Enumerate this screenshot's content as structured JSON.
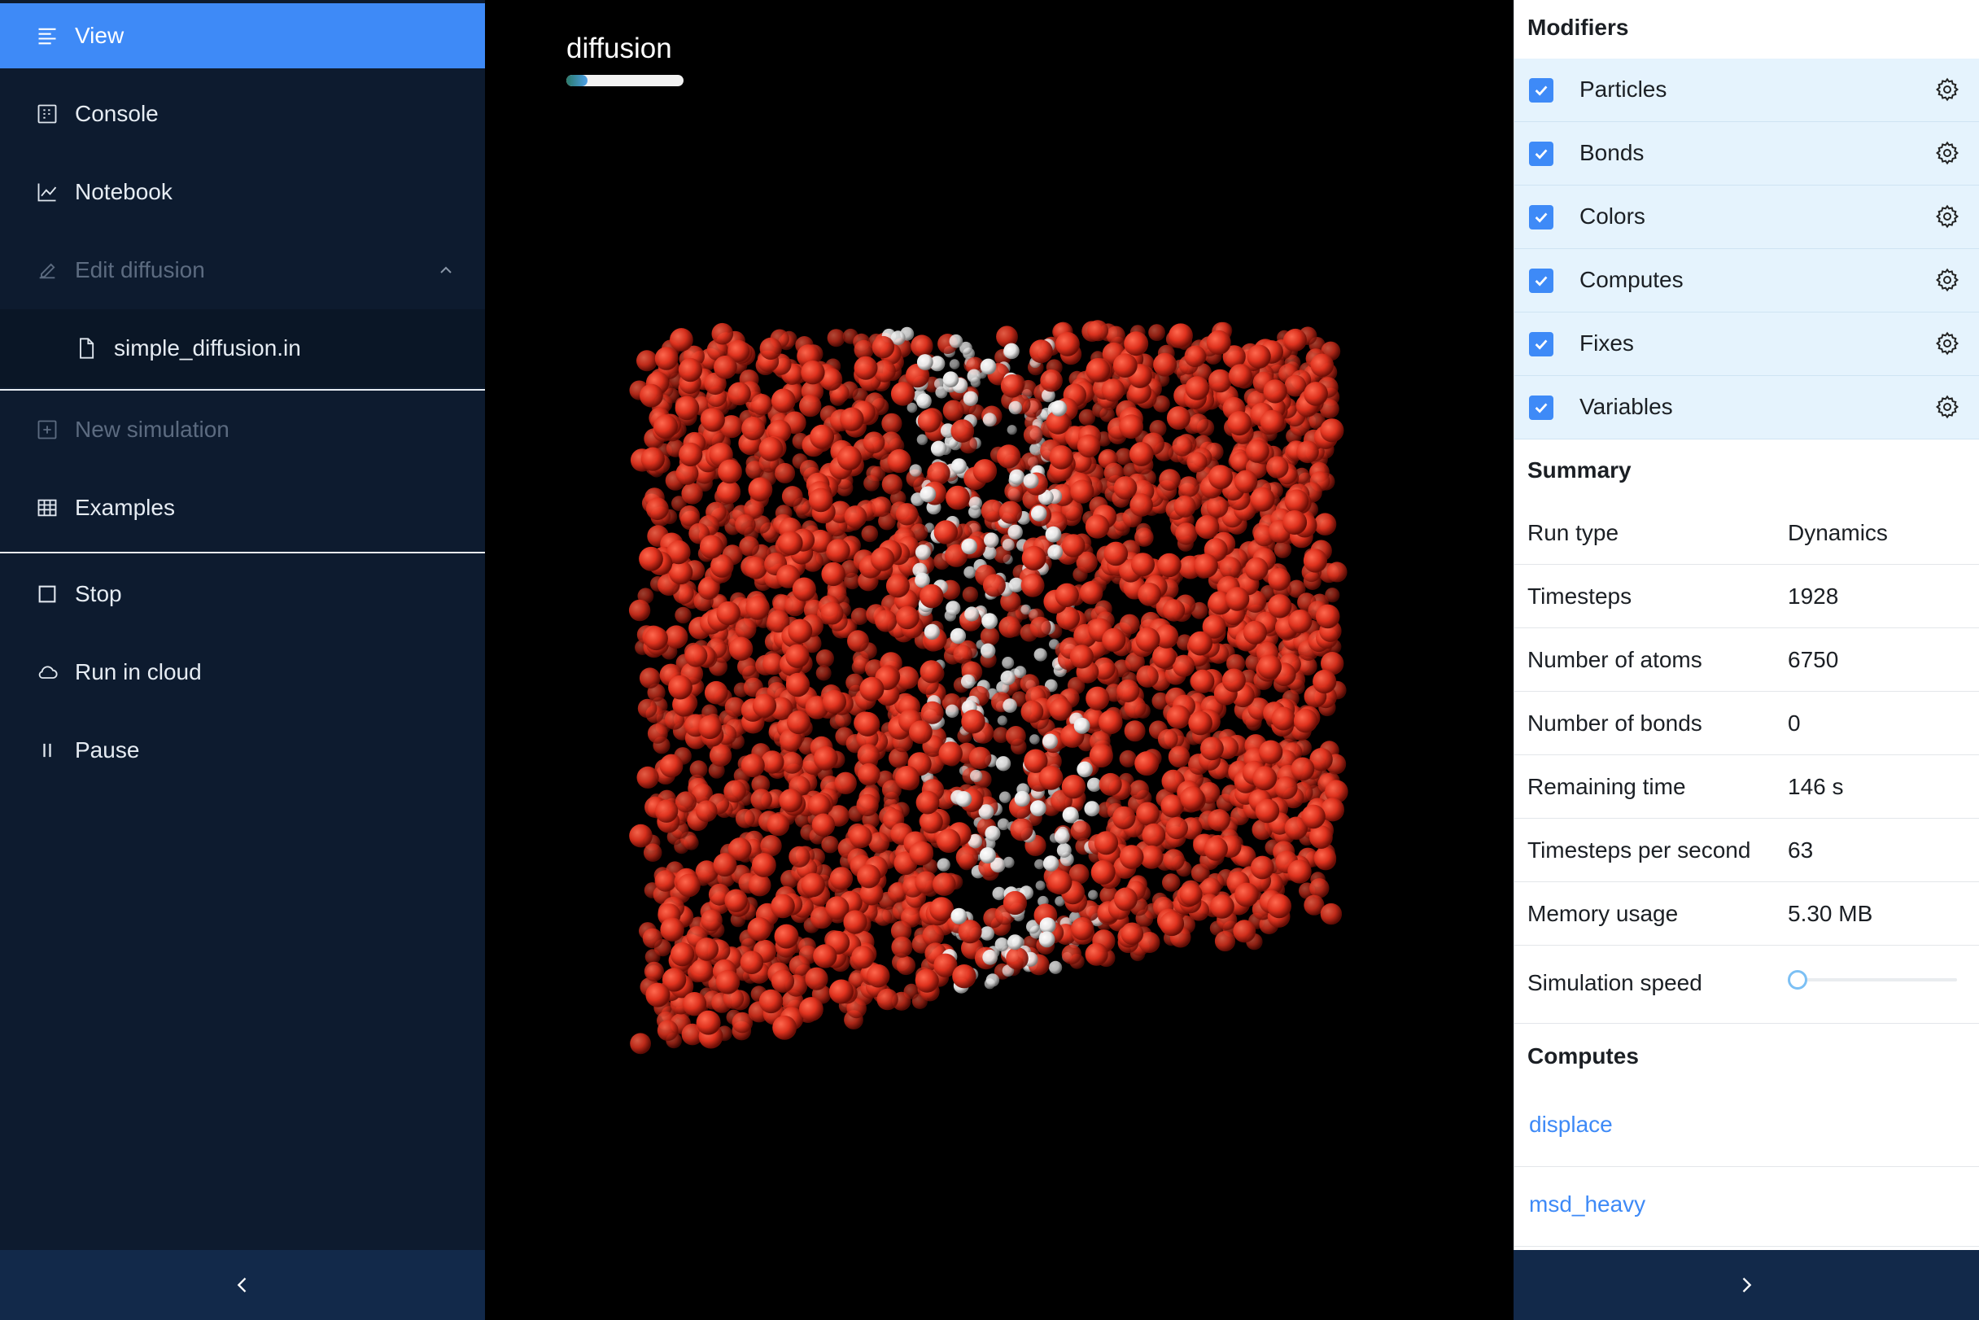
{
  "sidebar": {
    "items": [
      {
        "label": "View",
        "icon": "view-list-icon",
        "state": "active"
      },
      {
        "label": "Console",
        "icon": "console-icon",
        "state": "normal"
      },
      {
        "label": "Notebook",
        "icon": "chart-line-icon",
        "state": "normal"
      },
      {
        "label": "Edit diffusion",
        "icon": "edit-icon",
        "state": "disabled"
      },
      {
        "label": "simple_diffusion.in",
        "icon": "file-icon",
        "state": "normal"
      },
      {
        "label": "New simulation",
        "icon": "plus-square-icon",
        "state": "disabled"
      },
      {
        "label": "Examples",
        "icon": "table-icon",
        "state": "normal"
      },
      {
        "label": "Stop",
        "icon": "stop-icon",
        "state": "normal"
      },
      {
        "label": "Run in cloud",
        "icon": "cloud-icon",
        "state": "normal"
      },
      {
        "label": "Pause",
        "icon": "pause-icon",
        "state": "normal"
      }
    ],
    "collapse_icon": "chevron-left-icon"
  },
  "viewer": {
    "title": "diffusion",
    "progress_fraction": 0.18
  },
  "panel": {
    "modifiers_title": "Modifiers",
    "modifiers": [
      {
        "label": "Particles",
        "checked": true
      },
      {
        "label": "Bonds",
        "checked": true
      },
      {
        "label": "Colors",
        "checked": true
      },
      {
        "label": "Computes",
        "checked": true
      },
      {
        "label": "Fixes",
        "checked": true
      },
      {
        "label": "Variables",
        "checked": true
      }
    ],
    "summary_title": "Summary",
    "summary": [
      {
        "key": "Run type",
        "value": "Dynamics"
      },
      {
        "key": "Timesteps",
        "value": "1928"
      },
      {
        "key": "Number of atoms",
        "value": "6750"
      },
      {
        "key": "Number of bonds",
        "value": "0"
      },
      {
        "key": "Remaining time",
        "value": "146 s"
      },
      {
        "key": "Timesteps per second",
        "value": "63"
      },
      {
        "key": "Memory usage",
        "value": "5.30 MB"
      }
    ],
    "speed_label": "Simulation speed",
    "speed_value": 0.0,
    "computes_title": "Computes",
    "computes": [
      "displace",
      "msd_heavy"
    ],
    "expand_icon": "chevron-right-icon"
  },
  "colors": {
    "accent": "#3e8af7",
    "sidebar_bg": "#0d1b2f",
    "footer_bg": "#12294a",
    "modifier_bg": "#e5f3fd",
    "particle_heavy": "#e0321e",
    "particle_light": "#e8e8e8"
  }
}
